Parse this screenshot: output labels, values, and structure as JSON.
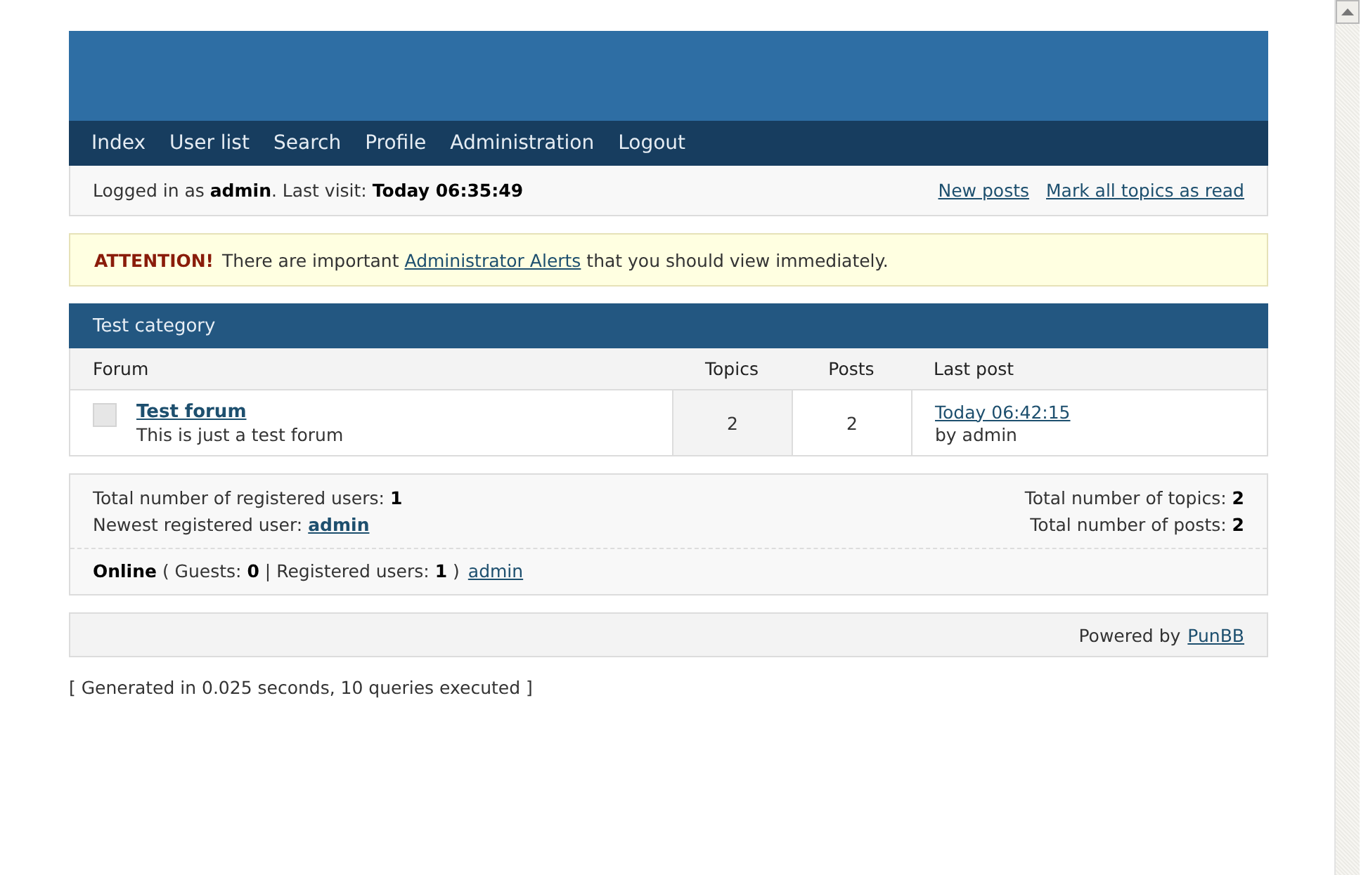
{
  "nav": [
    {
      "label": "Index"
    },
    {
      "label": "User list"
    },
    {
      "label": "Search"
    },
    {
      "label": "Profile"
    },
    {
      "label": "Administration"
    },
    {
      "label": "Logout"
    }
  ],
  "status": {
    "text": "Logged in as **admin**. Last visit: **Today 06:35:49**",
    "links": [
      "New posts",
      "Mark all topics as read"
    ]
  },
  "alert": {
    "label": "ATTENTION!",
    "before": "There are important",
    "link": "Administrator Alerts",
    "after": "that you should view immediately."
  },
  "category": {
    "title": "Test category",
    "columns": [
      "Forum",
      "Topics",
      "Posts",
      "Last post"
    ],
    "forums": [
      {
        "name": "Test forum",
        "description": "This is just a test forum",
        "topics": "2",
        "posts": "2",
        "last_post": "Today 06:42:15",
        "last_by": "by admin"
      }
    ]
  },
  "stats": {
    "users": "Total number of registered users: **1**",
    "newest_label": "Newest registered user:",
    "newest_user": "admin",
    "topics": "Total number of topics: **2**",
    "posts": "Total number of posts: **2**",
    "online": "**Online** ( Guests: **0** | Registered users: **1** )",
    "online_users": [
      "admin"
    ]
  },
  "footer": {
    "label": "Powered by",
    "link": "PunBB"
  },
  "generated": "[ Generated in 0.025 seconds, 10 queries executed ]"
}
